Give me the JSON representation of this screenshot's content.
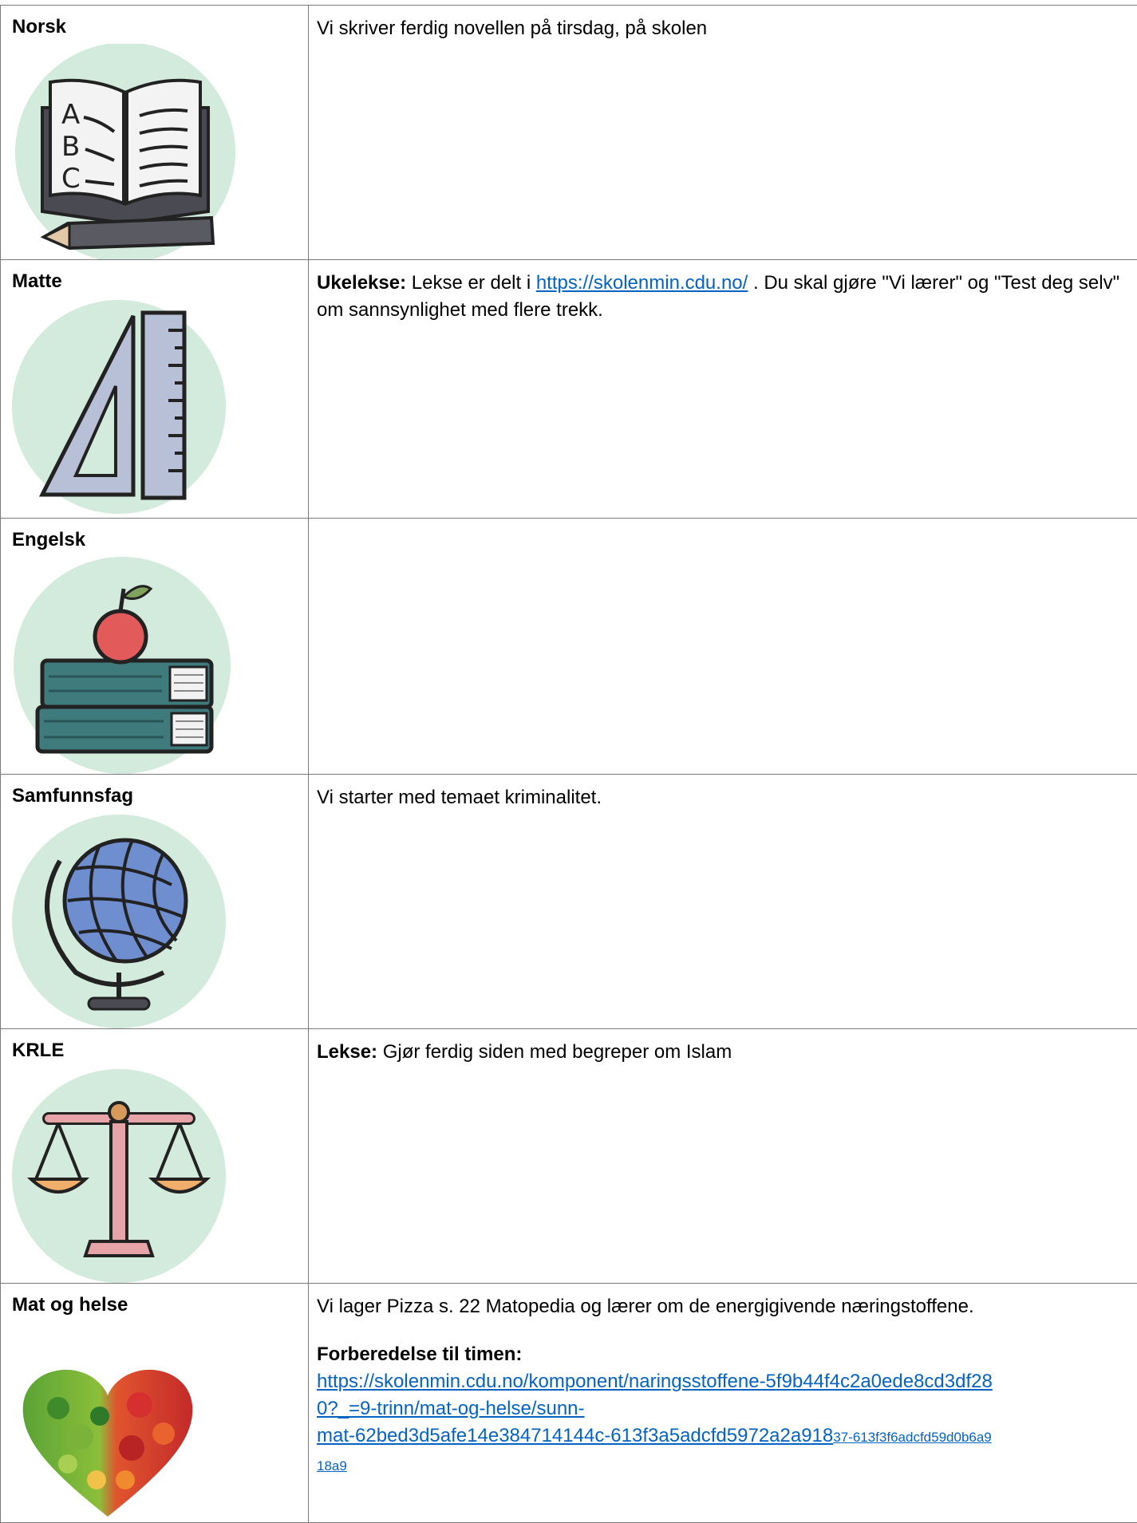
{
  "rows": [
    {
      "subject": "Norsk",
      "icon": "alphabet-book-icon",
      "content": {
        "text": "Vi skriver ferdig novellen på tirsdag, på skolen"
      }
    },
    {
      "subject": "Matte",
      "icon": "ruler-triangle-icon",
      "content": {
        "bold": "Ukelekse:",
        "pre": " Lekse er delt i  ",
        "link": "https://skolenmin.cdu.no/",
        "post": " . Du skal gjøre \"Vi lærer\" og \"Test deg selv\" om sannsynlighet med flere trekk."
      }
    },
    {
      "subject": "Engelsk",
      "icon": "apple-books-icon",
      "content": {
        "text": ""
      }
    },
    {
      "subject": "Samfunnsfag",
      "icon": "globe-icon",
      "content": {
        "text": "Vi starter med temaet kriminalitet."
      }
    },
    {
      "subject": "KRLE",
      "icon": "scales-icon",
      "content": {
        "bold": "Lekse:",
        "text": " Gjør ferdig siden med begreper om Islam"
      }
    },
    {
      "subject": "Mat og helse",
      "icon": "vegetable-heart-icon",
      "content": {
        "text": "Vi lager Pizza s. 22 Matopedia og lærer om de energigivende næringstoffene.",
        "prep_heading": "Forberedelse til timen:",
        "link_line1": "https://skolenmin.cdu.no/komponent/naringsstoffene-5f9b44f4c2a0ede8cd3df28",
        "link_line2": "0?_=9-trinn/mat-og-helse/sunn-",
        "link_line3_main": "mat-62bed3d5afe14e384714144c-613f3a5adcfd5972a2a918",
        "link_line3_small": "37-613f3f6adcfd59d0b6a9",
        "link_line4_small": "18a9"
      }
    }
  ],
  "colors": {
    "icon_bg": "#d3ebdc",
    "link": "#0563c1",
    "border": "#7a7a7a"
  }
}
